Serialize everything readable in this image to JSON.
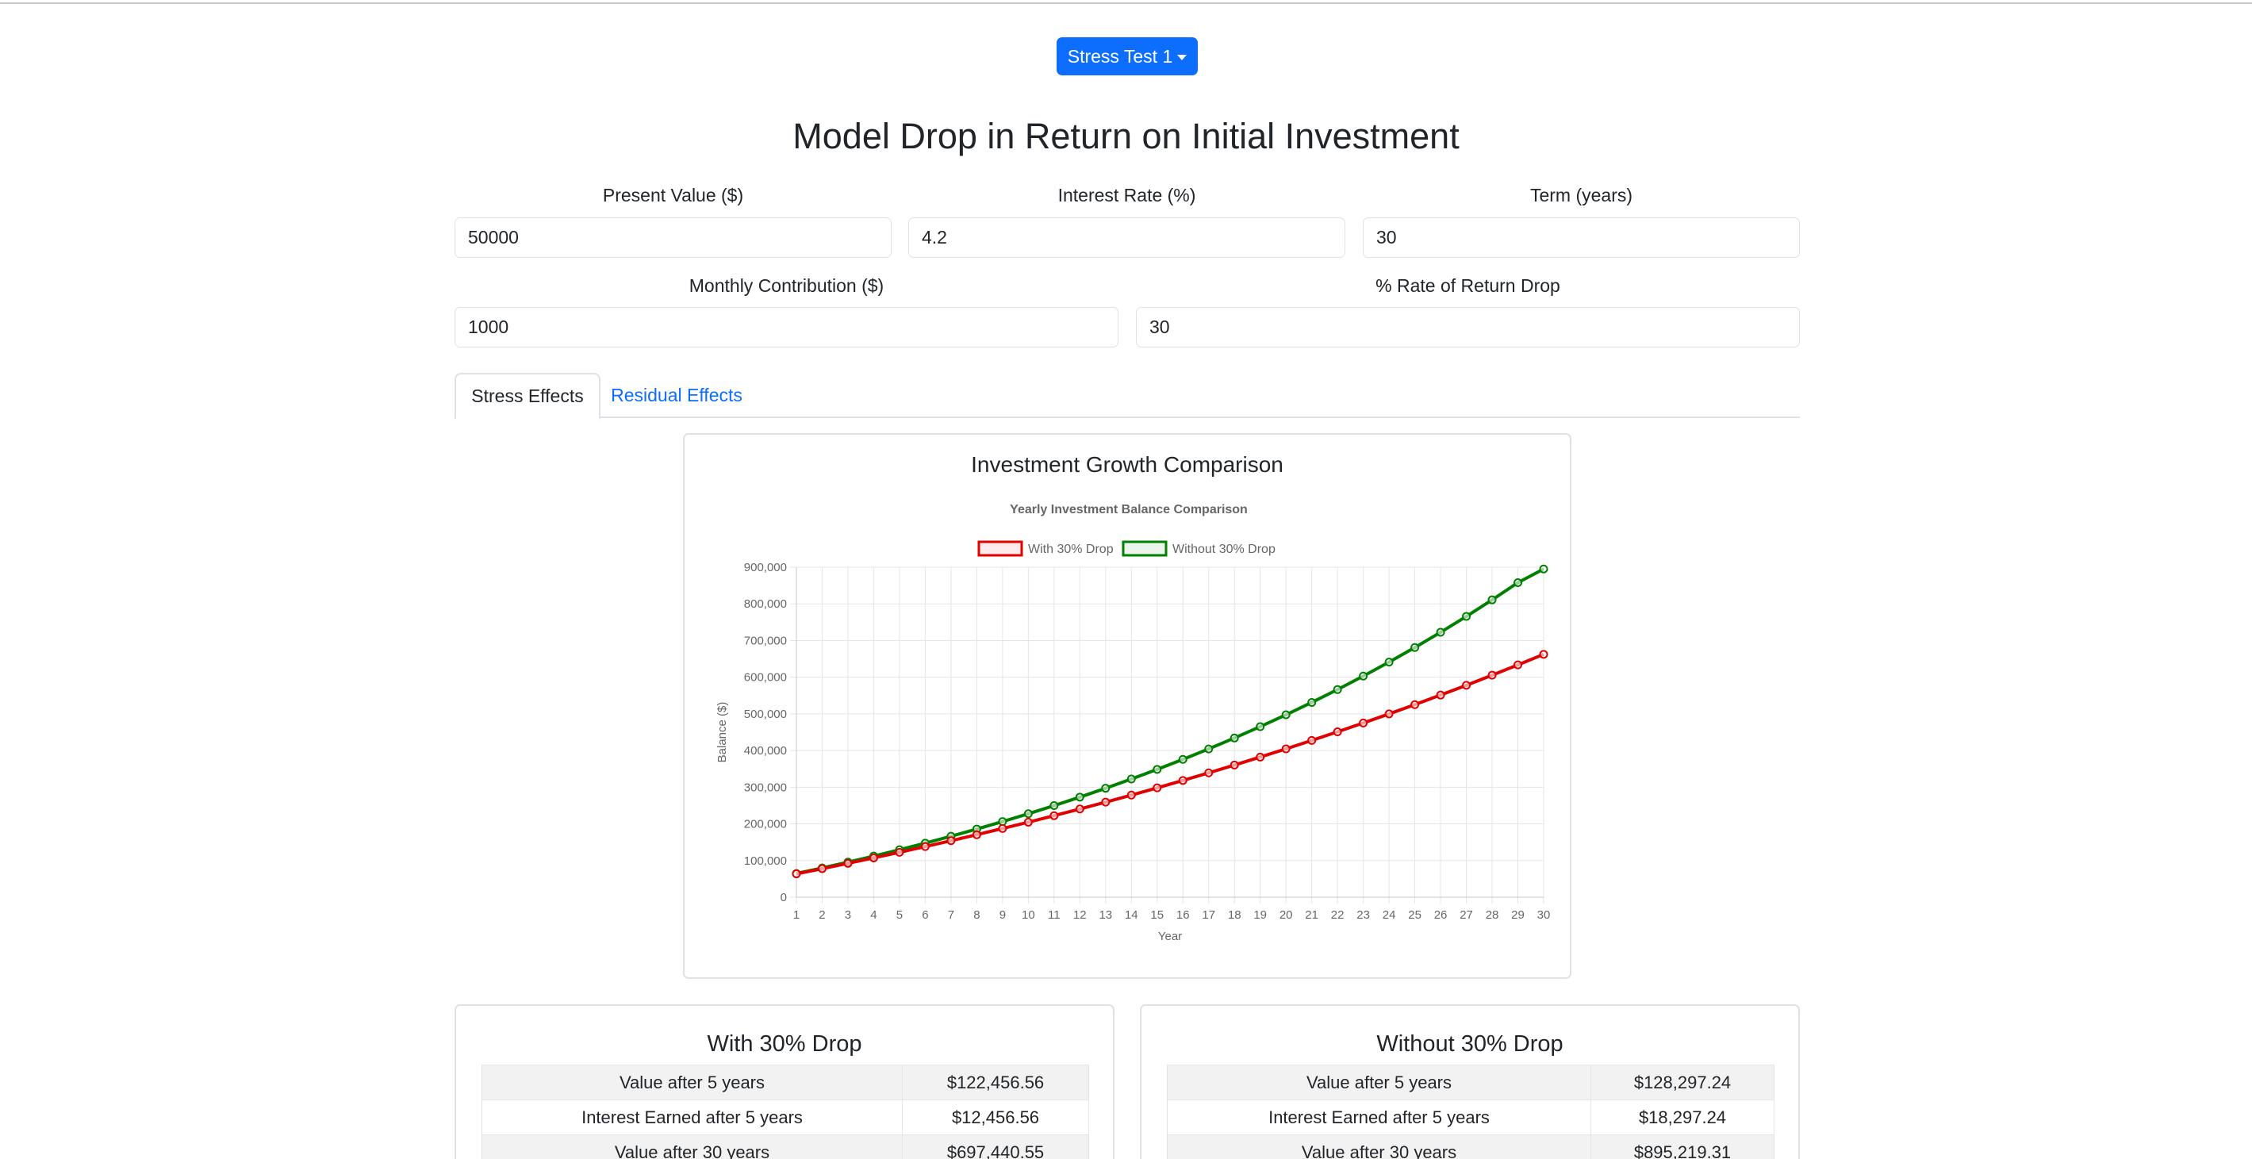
{
  "dropdown": {
    "label": "Stress Test 1"
  },
  "title": "Model Drop in Return on Initial Investment",
  "fields": {
    "present_value": {
      "label": "Present Value ($)",
      "value": "50000"
    },
    "interest_rate": {
      "label": "Interest Rate (%)",
      "value": "4.2"
    },
    "term": {
      "label": "Term (years)",
      "value": "30"
    },
    "monthly_contribution": {
      "label": "Monthly Contribution ($)",
      "value": "1000"
    },
    "rate_drop": {
      "label": "% Rate of Return Drop",
      "value": "30"
    }
  },
  "tabs": [
    {
      "label": "Stress Effects",
      "active": true
    },
    {
      "label": "Residual Effects",
      "active": false
    }
  ],
  "chart_card_title": "Investment Growth Comparison",
  "chart_data": {
    "type": "line",
    "title": "Yearly Investment Balance Comparison",
    "xlabel": "Year",
    "ylabel": "Balance ($)",
    "ylim": [
      0,
      900000
    ],
    "yticks": [
      "0",
      "100,000",
      "200,000",
      "300,000",
      "400,000",
      "500,000",
      "600,000",
      "700,000",
      "800,000",
      "900,000"
    ],
    "grid": true,
    "legend": "top",
    "x": [
      1,
      2,
      3,
      4,
      5,
      6,
      7,
      8,
      9,
      10,
      11,
      12,
      13,
      14,
      15,
      16,
      17,
      18,
      19,
      20,
      21,
      22,
      23,
      24,
      25,
      26,
      27,
      28,
      29,
      30
    ],
    "series": [
      {
        "name": "With 30% Drop",
        "color": "#e00000",
        "values": [
          63700,
          77800,
          92300,
          107200,
          122457,
          138100,
          154100,
          170500,
          187400,
          204600,
          222400,
          240600,
          259300,
          278500,
          298200,
          318400,
          339100,
          360400,
          382200,
          404500,
          427500,
          451000,
          475100,
          499900,
          525200,
          551300,
          578000,
          605400,
          633600,
          662400
        ]
      },
      {
        "name": "Without 30% Drop",
        "color": "#008000",
        "values": [
          64600,
          79800,
          95700,
          112200,
          129500,
          147500,
          166300,
          185900,
          206300,
          227600,
          249800,
          273000,
          297100,
          322300,
          348500,
          375900,
          404400,
          434200,
          465200,
          497500,
          531200,
          566300,
          603000,
          641200,
          681000,
          722500,
          765800,
          810900,
          857900,
          895219
        ]
      }
    ]
  },
  "results": {
    "with_drop": {
      "title": "With 30% Drop",
      "rows": [
        {
          "label": "Value after 5 years",
          "value": "$122,456.56"
        },
        {
          "label": "Interest Earned after 5 years",
          "value": "$12,456.56"
        },
        {
          "label": "Value after 30 years",
          "value": "$697,440.55"
        }
      ]
    },
    "without_drop": {
      "title": "Without 30% Drop",
      "rows": [
        {
          "label": "Value after 5 years",
          "value": "$128,297.24"
        },
        {
          "label": "Interest Earned after 5 years",
          "value": "$18,297.24"
        },
        {
          "label": "Value after 30 years",
          "value": "$895,219.31"
        }
      ]
    }
  }
}
